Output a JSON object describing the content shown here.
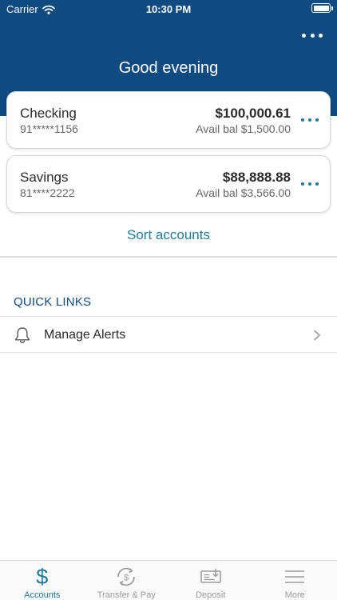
{
  "status_bar": {
    "carrier": "Carrier",
    "time": "10:30 PM",
    "wifi_icon": "wifi-icon",
    "battery_icon": "battery-icon"
  },
  "header": {
    "greeting": "Good evening",
    "more_icon": "more-horizontal-icon",
    "background_color": "#0f4a80"
  },
  "accounts": [
    {
      "name": "Checking",
      "number": "91*****1156",
      "balance": "$100,000.61",
      "avail": "Avail bal $1,500.00"
    },
    {
      "name": "Savings",
      "number": "81****2222",
      "balance": "$88,888.88",
      "avail": "Avail bal $3,566.00"
    }
  ],
  "sort_label": "Sort accounts",
  "quick_links": {
    "title": "QUICK LINKS",
    "items": [
      {
        "label": "Manage Alerts",
        "icon": "bell-icon"
      }
    ]
  },
  "tabs": [
    {
      "label": "Accounts",
      "icon": "dollar-icon",
      "active": true
    },
    {
      "label": "Transfer & Pay",
      "icon": "transfer-icon",
      "active": false
    },
    {
      "label": "Deposit",
      "icon": "deposit-check-icon",
      "active": false
    },
    {
      "label": "More",
      "icon": "menu-icon",
      "active": false
    }
  ],
  "colors": {
    "accent": "#1d7a9a",
    "brand": "#0f4a80",
    "inactive": "#9a9a9a"
  }
}
